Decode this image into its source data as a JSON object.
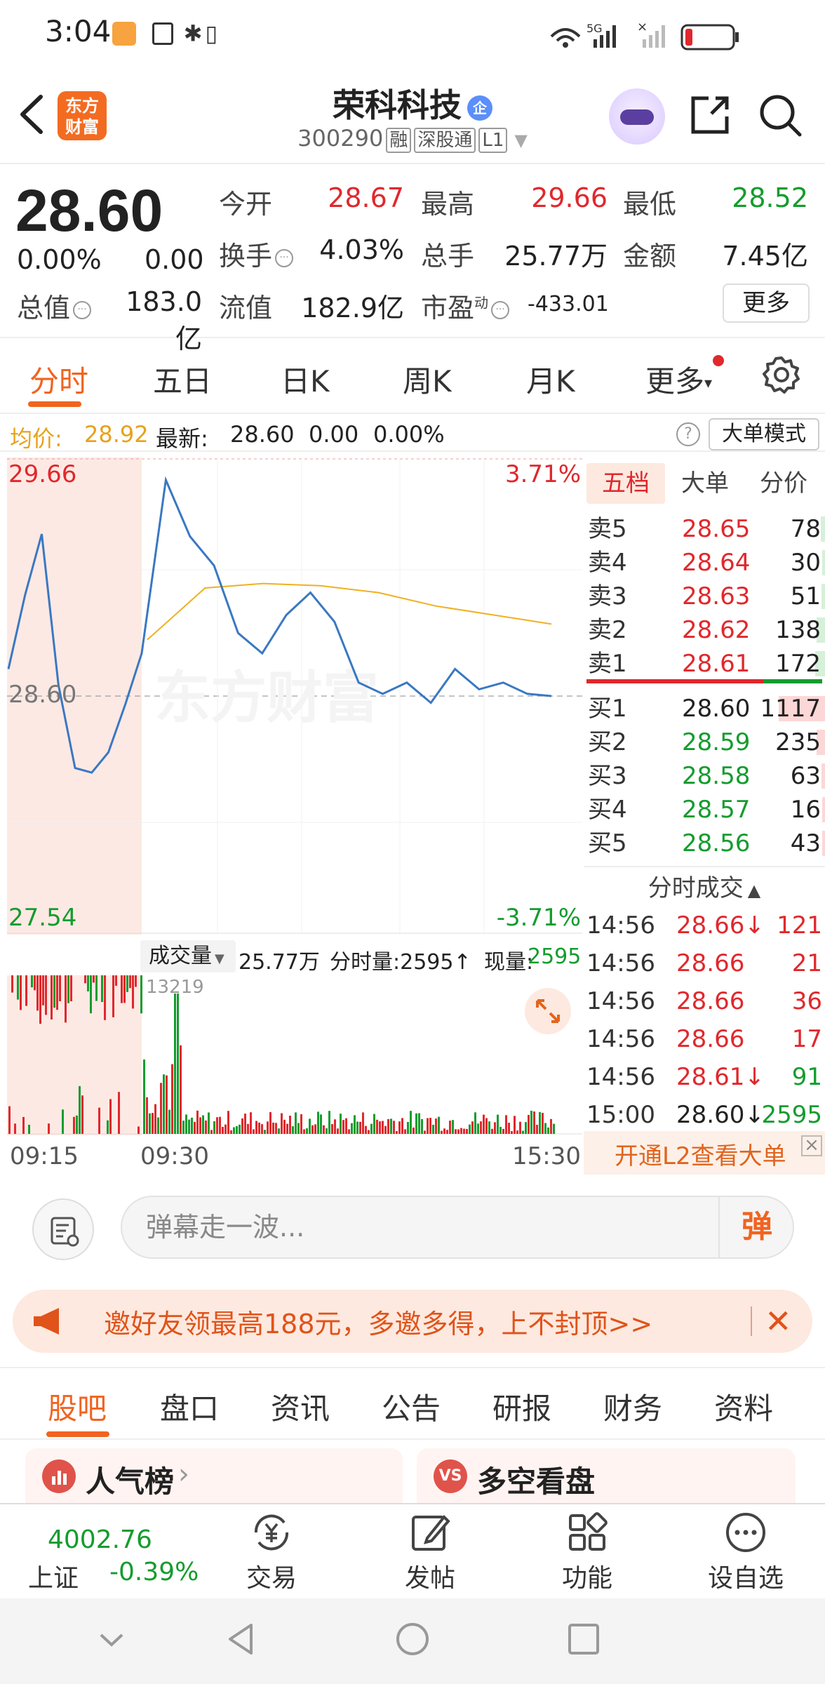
{
  "status_bar": {
    "time": "3:04"
  },
  "header": {
    "logo_line1": "东方",
    "logo_line2": "财富",
    "stock_name": "荣科科技",
    "enterprise_badge": "企",
    "stock_code": "300290",
    "tags": [
      "融",
      "深股通",
      "L1"
    ]
  },
  "quote": {
    "price": "28.60",
    "change_pct": "0.00%",
    "change_val": "0.00",
    "fields": [
      {
        "label": "今开",
        "value": "28.67",
        "color": "#e0282d"
      },
      {
        "label": "最高",
        "value": "29.66",
        "color": "#e0282d"
      },
      {
        "label": "最低",
        "value": "28.52",
        "color": "#149c2e"
      },
      {
        "label": "换手",
        "value": "4.03%",
        "color": "#222222"
      },
      {
        "label": "总手",
        "value": "25.77万",
        "color": "#222222"
      },
      {
        "label": "金额",
        "value": "7.45亿",
        "color": "#222222"
      },
      {
        "label": "总值",
        "value": "183.0亿",
        "color": "#222222"
      },
      {
        "label": "流值",
        "value": "182.9亿",
        "color": "#222222"
      },
      {
        "label": "市盈",
        "value": "-433.01",
        "color": "#222222"
      }
    ],
    "pe_superscript": "动",
    "more_label": "更多"
  },
  "period_tabs": [
    "分时",
    "五日",
    "日K",
    "周K",
    "月K",
    "更多"
  ],
  "avg_line": {
    "avg_label": "均价:",
    "avg_value": "28.92",
    "latest_label": "最新:",
    "latest_value": "28.60",
    "change": "0.00",
    "change_pct": "0.00%",
    "mode_label": "大单模式"
  },
  "chart_labels": {
    "high": "29.66",
    "high_pct": "3.71%",
    "mid": "28.60",
    "low": "27.54",
    "low_pct": "-3.71%",
    "watermark": "东方财富",
    "vol_dropdown": "成交量",
    "vol_total": "25.77万",
    "vol_period": "分时量:2595↑",
    "vol_now_label": "现量:",
    "vol_now": "2595",
    "vol_max": "13219",
    "time_start": "09:15",
    "time_open": "09:30",
    "time_end": "15:30"
  },
  "chart_data": {
    "type": "line",
    "title": "",
    "x_range": [
      "09:15",
      "15:30"
    ],
    "ylim": [
      27.54,
      29.66
    ],
    "y_pct_range": [
      "-3.71%",
      "3.71%"
    ],
    "prev_close": 28.6,
    "series": [],
    "price_trend_approx": [
      28.72,
      29.05,
      29.32,
      28.65,
      28.28,
      28.26,
      28.35,
      28.56,
      28.79,
      29.56,
      29.31,
      29.18,
      28.88,
      28.79,
      28.96,
      29.06,
      28.93,
      28.66,
      28.61,
      28.66,
      28.57,
      28.72,
      28.63,
      28.66,
      28.61,
      28.6
    ],
    "avg_trend_approx": [
      28.85,
      29.08,
      29.1,
      29.09,
      29.06,
      29.0,
      28.96,
      28.92
    ]
  },
  "order_book": {
    "tabs": [
      "五档",
      "大单",
      "分价"
    ],
    "asks": [
      {
        "label": "卖5",
        "price": "28.65",
        "vol": "78",
        "fill": 0.05
      },
      {
        "label": "卖4",
        "price": "28.64",
        "vol": "30",
        "fill": 0.03
      },
      {
        "label": "卖3",
        "price": "28.63",
        "vol": "51",
        "fill": 0.04
      },
      {
        "label": "卖2",
        "price": "28.62",
        "vol": "138",
        "fill": 0.1
      },
      {
        "label": "卖1",
        "price": "28.61",
        "vol": "172",
        "fill": 0.12
      }
    ],
    "bids": [
      {
        "label": "买1",
        "price": "28.60",
        "vol": "1117",
        "fill": 0.55
      },
      {
        "label": "买2",
        "price": "28.59",
        "vol": "235",
        "fill": 0.1
      },
      {
        "label": "买3",
        "price": "28.58",
        "vol": "63",
        "fill": 0.04
      },
      {
        "label": "买4",
        "price": "28.57",
        "vol": "16",
        "fill": 0.02
      },
      {
        "label": "买5",
        "price": "28.56",
        "vol": "43",
        "fill": 0.03
      }
    ],
    "ticks_header": "分时成交",
    "ticks": [
      {
        "time": "14:56",
        "price": "28.66↓",
        "vol": "121",
        "pcolor": "#e0282d",
        "vcolor": "#e0282d"
      },
      {
        "time": "14:56",
        "price": "28.66",
        "vol": "21",
        "pcolor": "#e0282d",
        "vcolor": "#e0282d"
      },
      {
        "time": "14:56",
        "price": "28.66",
        "vol": "36",
        "pcolor": "#e0282d",
        "vcolor": "#e0282d"
      },
      {
        "time": "14:56",
        "price": "28.66",
        "vol": "17",
        "pcolor": "#e0282d",
        "vcolor": "#e0282d"
      },
      {
        "time": "14:56",
        "price": "28.61↓",
        "vol": "91",
        "pcolor": "#e0282d",
        "vcolor": "#149c2e"
      },
      {
        "time": "15:00",
        "price": "28.60↓",
        "vol": "2595",
        "pcolor": "#222222",
        "vcolor": "#149c2e"
      }
    ],
    "l2_label": "开通L2查看大单"
  },
  "danmu": {
    "placeholder": "弹幕走一波...",
    "button": "弹"
  },
  "invite": {
    "text": "邀好友领最高188元，多邀多得，上不封顶>>"
  },
  "section_tabs": [
    "股吧",
    "盘口",
    "资讯",
    "公告",
    "研报",
    "财务",
    "资料"
  ],
  "cards": [
    {
      "icon": "人气",
      "title": "人气榜",
      "arrow": "›"
    },
    {
      "icon": "VS",
      "title": "多空看盘"
    }
  ],
  "bottom_nav": {
    "index_value": "4002.76",
    "index_name": "上证",
    "index_change": "-0.39%",
    "items": [
      "交易",
      "发帖",
      "功能",
      "设自选"
    ]
  },
  "colors": {
    "accent": "#f06420",
    "up": "#e0282d",
    "down": "#149c2e",
    "price_line": "#3a78c2",
    "avg_line": "#f0b020"
  }
}
